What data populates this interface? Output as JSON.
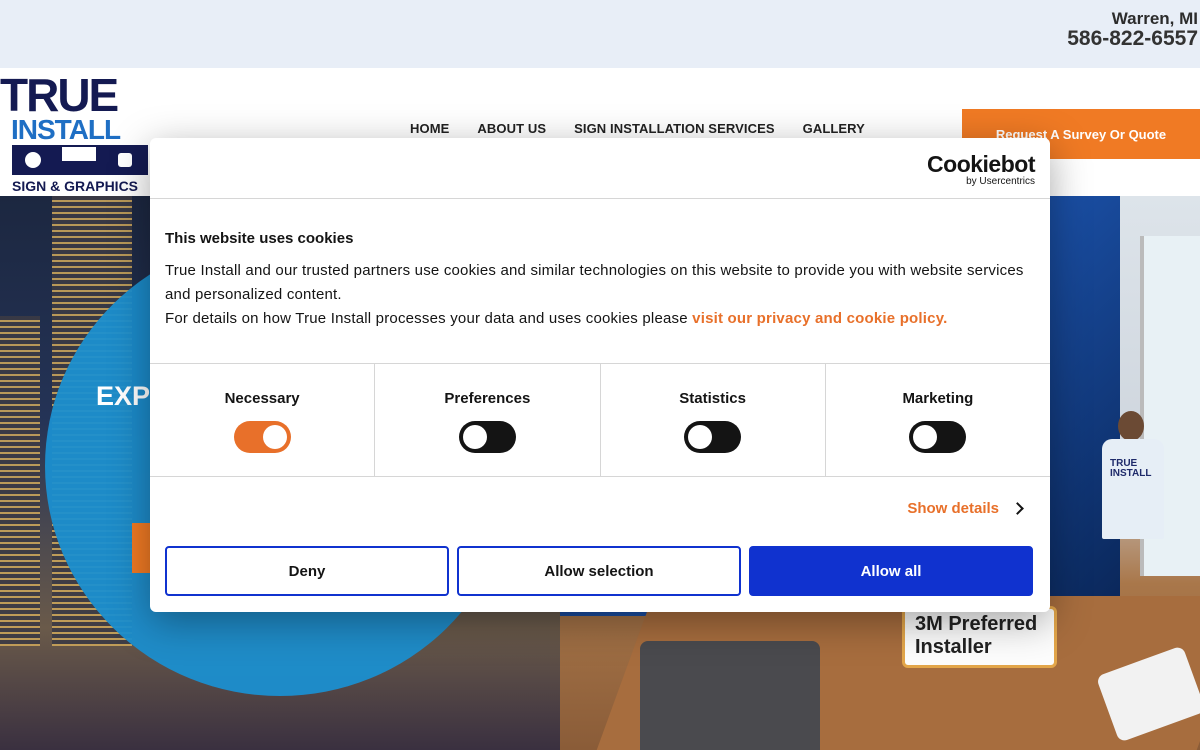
{
  "topbar": {
    "location": "Warren, MI",
    "phone": "586-822-6557"
  },
  "logo": {
    "line1": "TRUE",
    "line2": "INSTALL",
    "line3": "SIGN & GRAPHICS"
  },
  "nav": {
    "items": [
      "HOME",
      "ABOUT US",
      "SIGN INSTALLATION SERVICES",
      "GALLERY"
    ]
  },
  "cta": {
    "label": "Request A Survey Or Quote"
  },
  "hero": {
    "title_partial": "EXP",
    "badge_line1": "3M Preferred",
    "badge_line2": "Installer",
    "shirt_line1": "TRUE",
    "shirt_line2": "INSTALL"
  },
  "cookie": {
    "brand": "Cookiebot",
    "brand_sub": "by Usercentrics",
    "title": "This website uses cookies",
    "text1": "True Install and our trusted partners use cookies and similar technologies on this website to provide you with website services and personalized content.",
    "text2": "For details on how True Install processes your data and uses cookies please ",
    "link": "visit our privacy and cookie policy.",
    "categories": [
      {
        "label": "Necessary",
        "on": true
      },
      {
        "label": "Preferences",
        "on": false
      },
      {
        "label": "Statistics",
        "on": false
      },
      {
        "label": "Marketing",
        "on": false
      }
    ],
    "show_details": "Show details",
    "deny": "Deny",
    "allow_selection": "Allow selection",
    "allow_all": "Allow all"
  },
  "colors": {
    "accent": "#f07a24",
    "cookie_blue": "#1032cf",
    "logo_navy": "#141a52",
    "logo_blue": "#1f6fc4"
  }
}
